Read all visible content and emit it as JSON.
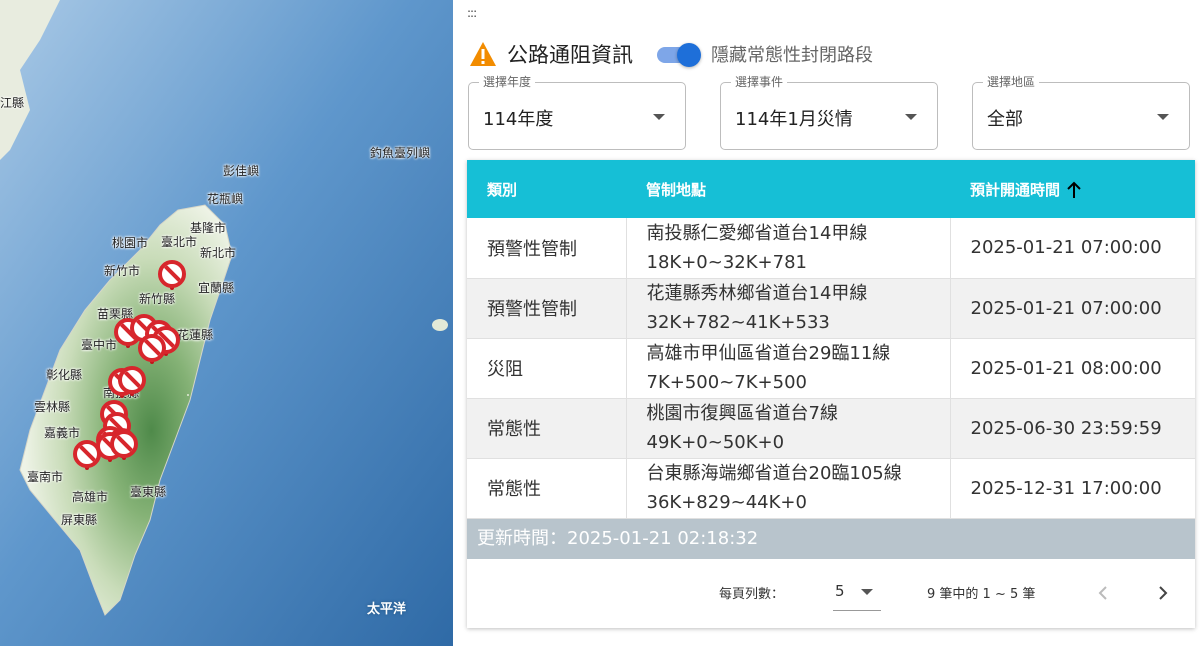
{
  "map": {
    "labels": [
      {
        "name": "taipei-city",
        "text": "臺北市"
      },
      {
        "name": "keelung-city",
        "text": "基隆市"
      },
      {
        "name": "taoyuan-city",
        "text": "桃園市"
      },
      {
        "name": "new-taipei-city",
        "text": "新北市"
      },
      {
        "name": "hsinchu-city",
        "text": "新竹市"
      },
      {
        "name": "hsinchu-county",
        "text": "新竹縣"
      },
      {
        "name": "yilan-county",
        "text": "宜蘭縣"
      },
      {
        "name": "miaoli-county",
        "text": "苗栗縣"
      },
      {
        "name": "taichung-city",
        "text": "臺中市"
      },
      {
        "name": "hualien-county",
        "text": "花蓮縣"
      },
      {
        "name": "changhua-county",
        "text": "彰化縣"
      },
      {
        "name": "nantou-county",
        "text": "南投縣"
      },
      {
        "name": "yunlin-county",
        "text": "雲林縣"
      },
      {
        "name": "chiayi-city",
        "text": "嘉義市"
      },
      {
        "name": "tainan-city",
        "text": "臺南市"
      },
      {
        "name": "kaohsiung-city",
        "text": "高雄市"
      },
      {
        "name": "taitung-county",
        "text": "臺東縣"
      },
      {
        "name": "pingtung-county",
        "text": "屏東縣"
      },
      {
        "name": "penghu-county",
        "text": "彭佳嶼"
      },
      {
        "name": "huaping-islet",
        "text": "花瓶嶼"
      },
      {
        "name": "diaoyutai",
        "text": "釣魚臺列嶼"
      },
      {
        "name": "lianjiang",
        "text": "江縣"
      },
      {
        "name": "pacific-ocean",
        "text": "太平洋",
        "sea": true
      }
    ]
  },
  "panel": {
    "drag_handle": ":::",
    "title": "公路通阻資訊",
    "toggle_label": "隱藏常態性封閉路段",
    "toggle_on": true,
    "filters": {
      "year": {
        "legend": "選擇年度",
        "value": "114年度"
      },
      "event": {
        "legend": "選擇事件",
        "value": "114年1月災情"
      },
      "region": {
        "legend": "選擇地區",
        "value": "全部"
      }
    },
    "table": {
      "headers": {
        "category": "類別",
        "location": "管制地點",
        "eta": "預計開通時間"
      },
      "rows": [
        {
          "category": "預警性管制",
          "location_line1": "南投縣仁愛鄉省道台14甲線",
          "location_line2": "18K+0~32K+781",
          "eta": "2025-01-21 07:00:00"
        },
        {
          "category": "預警性管制",
          "location_line1": "花蓮縣秀林鄉省道台14甲線",
          "location_line2": "32K+782~41K+533",
          "eta": "2025-01-21 07:00:00"
        },
        {
          "category": "災阻",
          "location_line1": "高雄市甲仙區省道台29臨11線",
          "location_line2": "7K+500~7K+500",
          "eta": "2025-01-21 08:00:00"
        },
        {
          "category": "常態性",
          "location_line1": "桃園市復興區省道台7線",
          "location_line2": "49K+0~50K+0",
          "eta": "2025-06-30 23:59:59"
        },
        {
          "category": "常態性",
          "location_line1": "台東縣海端鄉省道台20臨105線",
          "location_line2": "36K+829~44K+0",
          "eta": "2025-12-31 17:00:00"
        }
      ]
    },
    "update_time": "更新時間：2025-01-21 02:18:32",
    "pager": {
      "rows_label": "每頁列數：",
      "rows_value": "5",
      "range": "9 筆中的 1 ~ 5 筆"
    },
    "colors": {
      "header_bg": "#16bfd6",
      "toggle": "#1e6fd9",
      "update_bar": "#b8c4cc",
      "warning": "#f28c00",
      "marker": "#d7262c"
    }
  }
}
